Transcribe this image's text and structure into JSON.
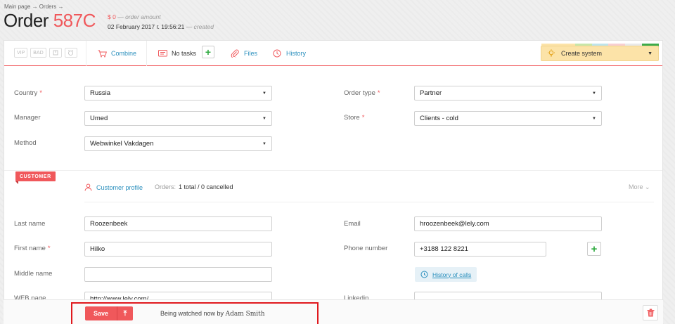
{
  "header": {
    "breadcrumb": "Main page → Orders →",
    "title_prefix": "Order",
    "order_number": "587C",
    "amount": "$ 0",
    "amount_note": "— order amount",
    "date": "02 February 2017 г. 19:56:21",
    "date_note": "— created"
  },
  "toolbar": {
    "tags": [
      "VIP",
      "BAD",
      "",
      ""
    ],
    "combine_label": "Combine",
    "tasks_label": "No tasks",
    "add_task_label": "+",
    "files_label": "Files",
    "history_label": "History",
    "create_system_label": "Create system",
    "strip_colors": [
      "#fce3a8",
      "#fce3a8",
      "#c8e6a8",
      "#bfe4ea",
      "#f8cfd1",
      "#e9e9e9",
      "#3eab4a"
    ]
  },
  "order_form": {
    "country_label": "Country",
    "country_value": "Russia",
    "manager_label": "Manager",
    "manager_value": "Umed",
    "method_label": "Method",
    "method_value": "Webwinkel Vakdagen",
    "order_type_label": "Order type",
    "order_type_value": "Partner",
    "store_label": "Store",
    "store_value": "Clients - cold",
    "required_mark": "*"
  },
  "customer": {
    "badge": "CUSTOMER",
    "profile_label": "Customer profile",
    "orders_label": "Orders:",
    "orders_value": "1 total / 0 cancelled",
    "more_label": "More",
    "last_name_label": "Last name",
    "last_name_value": "Roozenbeek",
    "first_name_label": "First name",
    "first_name_value": "Hilko",
    "middle_name_label": "Middle name",
    "middle_name_value": "",
    "web_label": "WEB page",
    "web_value": "http://www.lely.com/",
    "email_label": "Email",
    "email_value": "hroozenbeek@lely.com",
    "phone_label": "Phone number",
    "phone_value": "+3188 122 8221",
    "phone_add_label": "+",
    "history_calls_label": "History of calls",
    "linkedin_label": "Linkedin",
    "linkedin_value": ""
  },
  "footer": {
    "save_label": "Save",
    "save_arrow": "⤒",
    "watching_text": "Being watched now by",
    "watching_user": "Adam Smith"
  },
  "colors": {
    "accent": "#f0585b",
    "link": "#2a8fbd",
    "success": "#2eaa3f",
    "highlight": "#e0191e"
  }
}
